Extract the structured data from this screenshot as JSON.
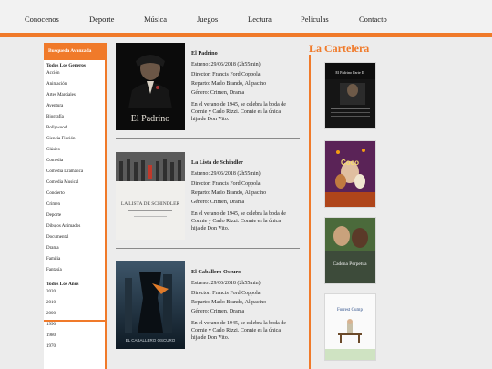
{
  "nav": [
    "Conocenos",
    "Deporte",
    "Música",
    "Juegos",
    "Lectura",
    "Peliculas",
    "Contacto"
  ],
  "sidebar": {
    "header": "Busqueda Avanzada",
    "genres_title": "Todos Los Generos",
    "genres": [
      "Acción",
      "Animación",
      "Artes Marciales",
      "Aventura",
      "Biografía",
      "Bollywood",
      "Ciencia Ficción",
      "Clásico",
      "Comedia",
      "Comedia Dramática",
      "Comedia Musical",
      "Concierto",
      "Crimen",
      "Deporte",
      "Dibujos Animados",
      "Documental",
      "Drama",
      "Familia",
      "Fantasía"
    ],
    "years_title": "Todos Los Años",
    "years": [
      "2020",
      "2010",
      "2000",
      "1990",
      "1980",
      "1970"
    ]
  },
  "movies": [
    {
      "title": "El Padrino",
      "release": "Estreno: 29/06/2018 (2h55min)",
      "director": "Director: Francis Ford Coppola",
      "cast": "Reparto: Marlo Brando, Al pacino",
      "genre": "Género: Crimen, Drama",
      "synopsis": [
        "En el verano de 1945, se celebra la boda de",
        "Connie y Carlo Rizzi. Connie es la única",
        "hija de Don Vito."
      ],
      "poster_text": "El Padrino"
    },
    {
      "title": "La Lista de Schindler",
      "release": "Estreno: 29/06/2018 (2h55min)",
      "director": "Director: Francis Ford Coppola",
      "cast": "Reparto: Marlo Brando, Al pacino",
      "genre": "Género: Crimen, Drama",
      "synopsis": [
        "En el verano de 1945, se celebra la boda de",
        "Connie y Carlo Rizzi. Connie es la única",
        "hija de Don Vito."
      ],
      "poster_text": "LA LISTA DE SCHINDLER"
    },
    {
      "title": "El Caballero Oscuro",
      "release": "Estreno: 29/06/2018 (2h55min)",
      "director": "Director: Francis Ford Coppola",
      "cast": "Reparto: Marlo Brando, Al pacino",
      "genre": "Género: Crimen, Drama",
      "synopsis": [
        "En el verano de 1945, se celebra la boda de",
        "Connie y Carlo Rizzi. Connie es la única",
        "hija de Don Vito."
      ],
      "poster_text": "EL CABALLERO OSCURO"
    }
  ],
  "cartelera": {
    "title": "La Cartelera",
    "posters": [
      "El Padrino Parte II",
      "Coco",
      "Cadena Perpetua",
      "Forrest Gump"
    ]
  },
  "colors": {
    "accent": "#f07a2a",
    "background": "#ececec"
  }
}
